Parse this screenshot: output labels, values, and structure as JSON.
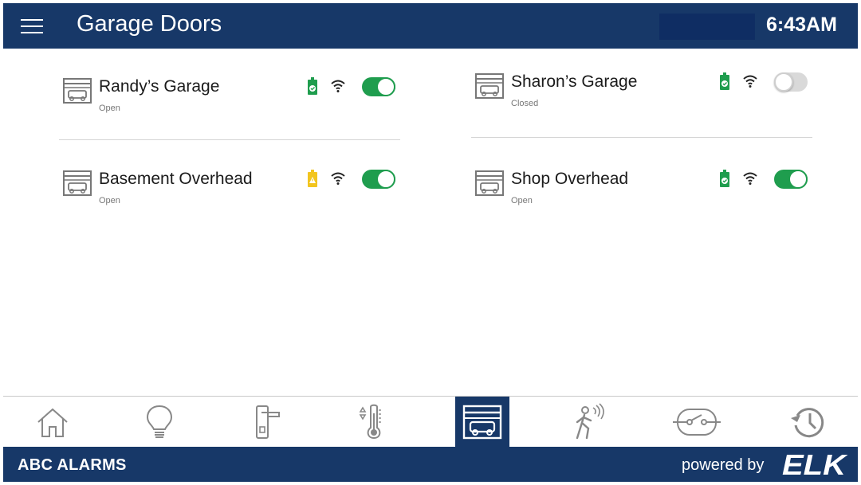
{
  "header": {
    "title": "Garage Doors",
    "time": "6:43AM"
  },
  "doors": [
    {
      "name": "Randy’s Garage",
      "status": "Open",
      "battery": "ok",
      "toggle_on": true
    },
    {
      "name": "Sharon’s Garage",
      "status": "Closed",
      "battery": "ok",
      "toggle_on": false
    },
    {
      "name": "Basement Overhead",
      "status": "Open",
      "battery": "warning",
      "toggle_on": true
    },
    {
      "name": "Shop Overhead",
      "status": "Open",
      "battery": "ok",
      "toggle_on": true
    }
  ],
  "nav": [
    {
      "icon": "home-icon",
      "active": false
    },
    {
      "icon": "lightbulb-icon",
      "active": false
    },
    {
      "icon": "door-lock-icon",
      "active": false
    },
    {
      "icon": "thermostat-icon",
      "active": false
    },
    {
      "icon": "garage-icon",
      "active": true
    },
    {
      "icon": "motion-sensor-icon",
      "active": false
    },
    {
      "icon": "switch-icon",
      "active": false
    },
    {
      "icon": "history-icon",
      "active": false
    }
  ],
  "footer": {
    "company": "ABC ALARMS",
    "powered_by": "powered by",
    "brand": "ELK"
  },
  "colors": {
    "primary": "#173868",
    "toggle_on": "#1f9d4e",
    "battery_ok": "#1f9d4e",
    "battery_warning": "#f2c51f"
  }
}
